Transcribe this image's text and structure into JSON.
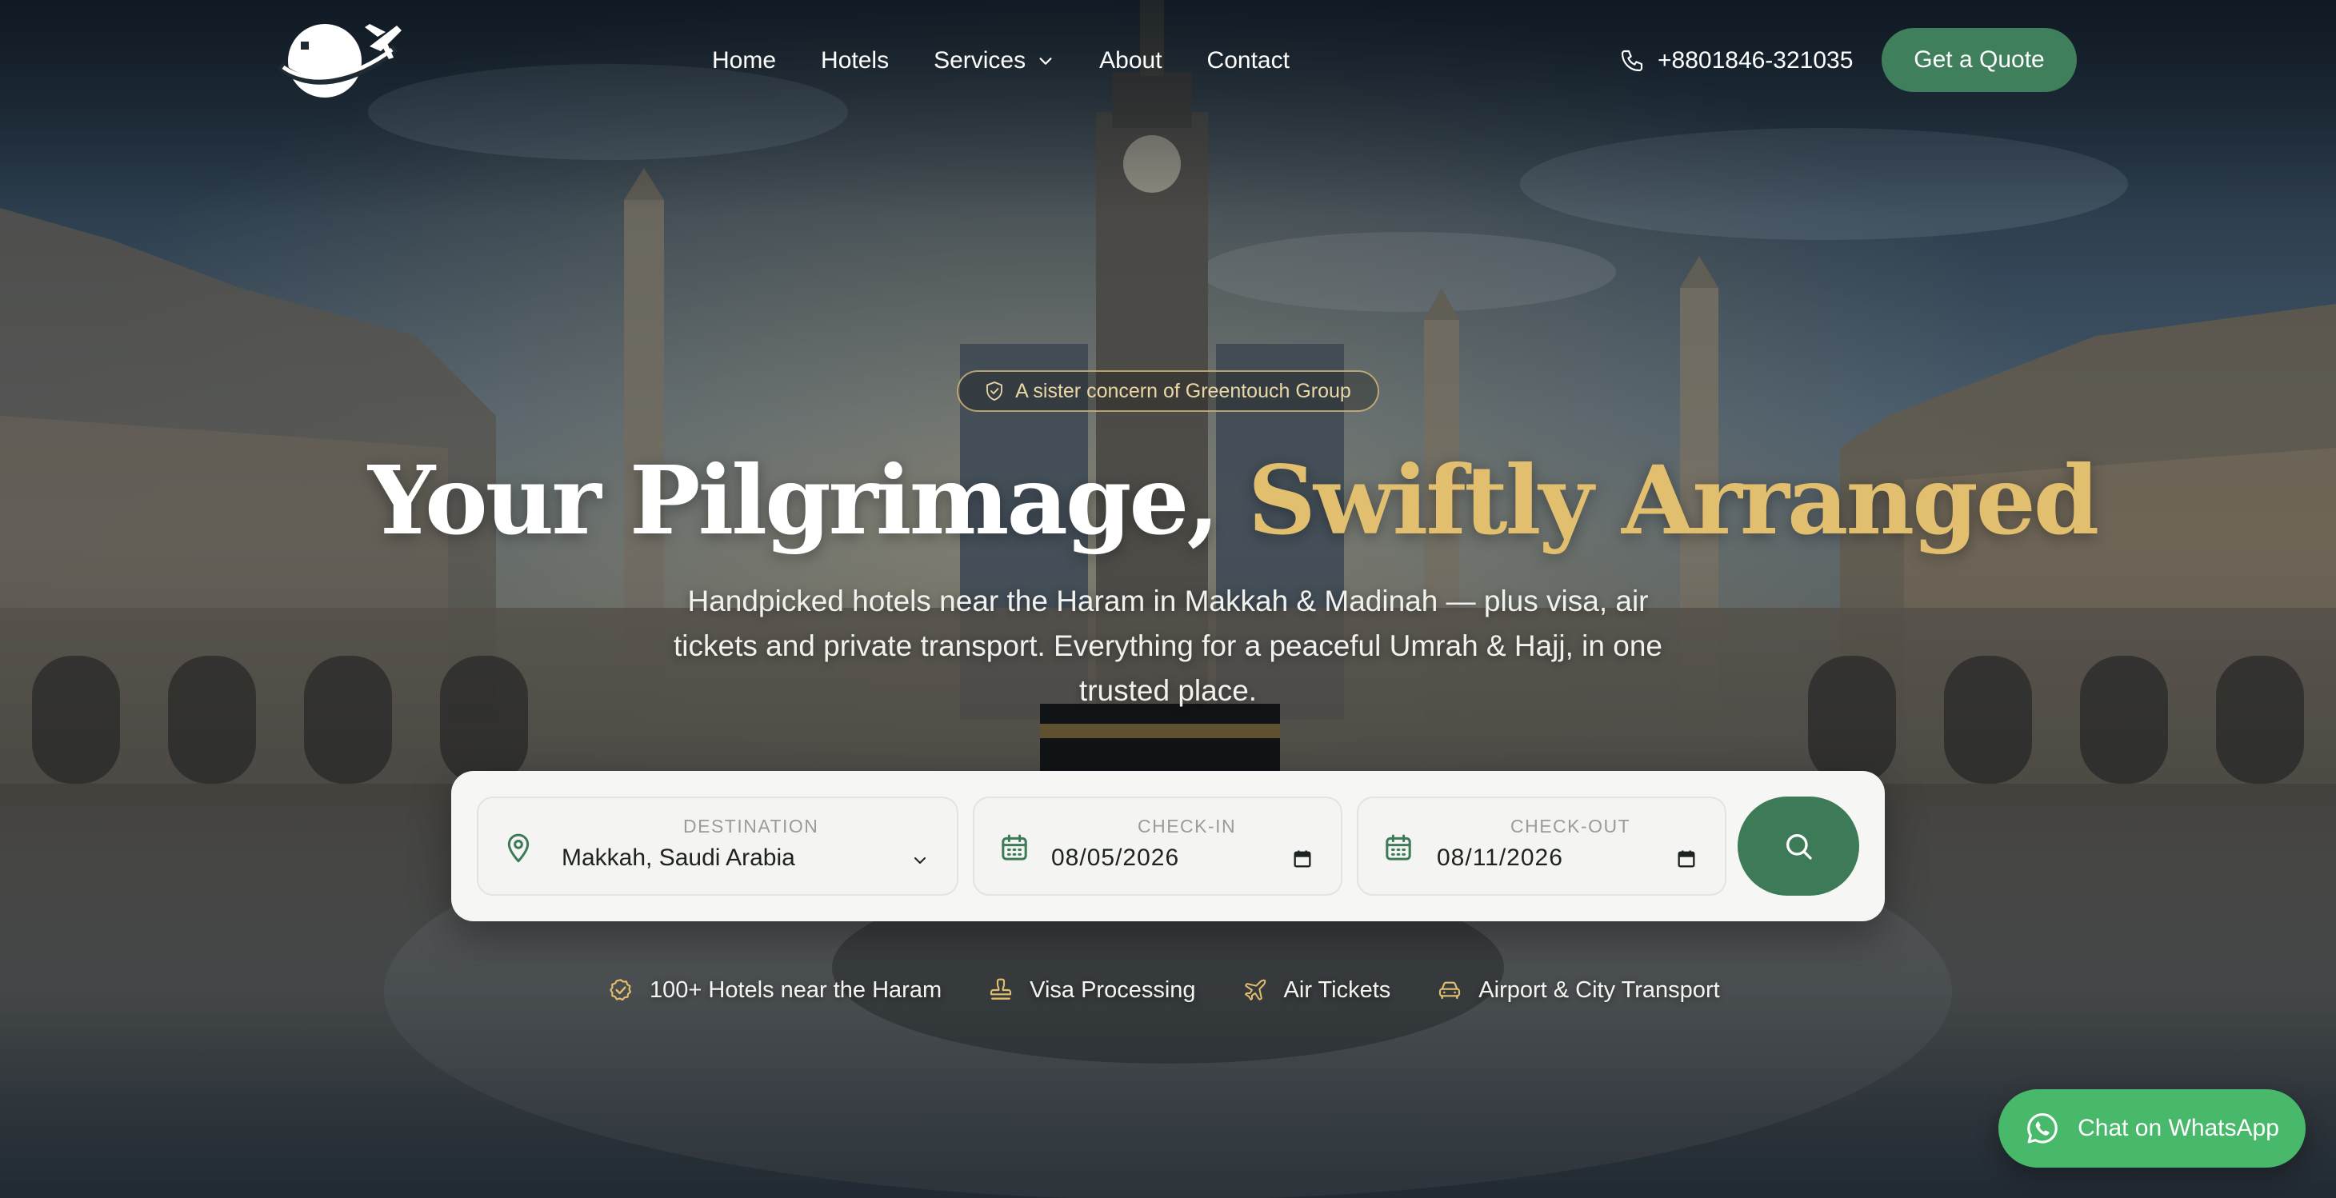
{
  "brand": {
    "logo_icon": "globe-with-airplane-logo"
  },
  "nav": {
    "items": [
      {
        "label": "Home"
      },
      {
        "label": "Hotels"
      },
      {
        "label": "Services"
      },
      {
        "label": "About"
      },
      {
        "label": "Contact"
      }
    ]
  },
  "header": {
    "phone": "+8801846-321035",
    "quote_label": "Get a Quote"
  },
  "hero": {
    "badge": "A sister concern of Greentouch Group",
    "headline_main": "Your Pilgrimage, ",
    "headline_accent": "Swiftly Arranged",
    "subtext": "Handpicked hotels near the Haram in Makkah & Madinah — plus visa, air tickets and private transport. Everything for a peaceful Umrah & Hajj, in one trusted place."
  },
  "search": {
    "destination": {
      "label": "DESTINATION",
      "value": "Makkah, Saudi Arabia"
    },
    "checkin": {
      "label": "CHECK-IN",
      "value": "08/05/2026"
    },
    "checkout": {
      "label": "CHECK-OUT",
      "value": "08/11/2026"
    }
  },
  "features": [
    {
      "label": "100+ Hotels near the Haram",
      "icon": "check-circle-icon"
    },
    {
      "label": "Visa Processing",
      "icon": "stamp-icon"
    },
    {
      "label": "Air Tickets",
      "icon": "plane-icon"
    },
    {
      "label": "Airport & City Transport",
      "icon": "car-icon"
    }
  ],
  "whatsapp": {
    "label": "Chat on WhatsApp"
  },
  "colors": {
    "primary_green": "#3f7f5b",
    "accent_gold": "#e2bf6e",
    "whatsapp_green": "#48b96a"
  }
}
